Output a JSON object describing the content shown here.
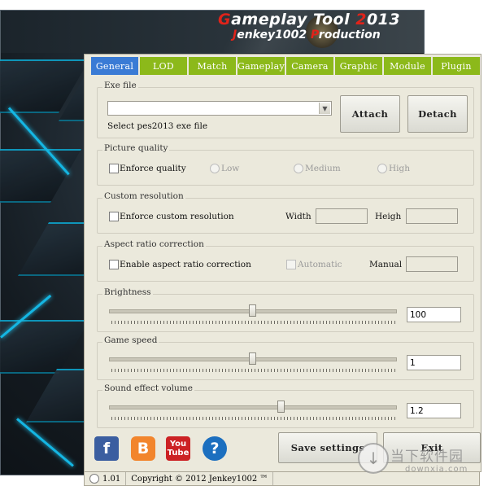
{
  "app": {
    "brand": {
      "title_first_letter": "G",
      "title_rest": "ameplay Tool ",
      "title_year_mark": "2",
      "title_year_rest": "013",
      "sub_first": "J",
      "sub_mid": "enkey1002 ",
      "sub_p": "P",
      "sub_rest": "roduction"
    },
    "tabs": [
      "General",
      "LOD",
      "Match",
      "Gameplay",
      "Camera",
      "Graphic",
      "Module",
      "Plugin"
    ],
    "active_tab": "General",
    "colors": {
      "tab_green": "#8cb91a",
      "tab_active": "#3a7bd5",
      "panel_bg": "#ebe9dc",
      "brand_red": "#e0231a",
      "accent_glow": "#14b6e3"
    }
  },
  "exe_file": {
    "title": "Exe file",
    "combo_value": "",
    "hint": "Select pes2013 exe file",
    "attach_label": "Attach",
    "detach_label": "Detach"
  },
  "picture_quality": {
    "title": "Picture quality",
    "enforce_label": "Enforce quality",
    "low_label": "Low",
    "medium_label": "Medium",
    "high_label": "High"
  },
  "custom_resolution": {
    "title": "Custom resolution",
    "enforce_label": "Enforce custom resolution",
    "width_label": "Width",
    "width_value": "",
    "height_label": "Heigh",
    "height_value": ""
  },
  "aspect_ratio": {
    "title": "Aspect ratio correction",
    "enable_label": "Enable aspect ratio correction",
    "automatic_label": "Automatic",
    "manual_label": "Manual",
    "manual_value": ""
  },
  "brightness": {
    "title": "Brightness",
    "value": "100",
    "level": 0.5
  },
  "game_speed": {
    "title": "Game speed",
    "value": "1",
    "level": 0.5
  },
  "sound_volume": {
    "title": "Sound effect volume",
    "value": "1.2",
    "level": 0.6
  },
  "footer": {
    "save_label": "Save settings",
    "exit_label": "Exit",
    "social": {
      "facebook": "f",
      "blogger": "B",
      "youtube_top": "You",
      "youtube_bottom": "Tube",
      "help": "?"
    }
  },
  "status": {
    "version": "1.01",
    "copyright": "Copyright © 2012 Jenkey1002 ™"
  },
  "watermark": {
    "cn": "当下软件园",
    "en": "downxia.com",
    "glyph": "↓"
  }
}
